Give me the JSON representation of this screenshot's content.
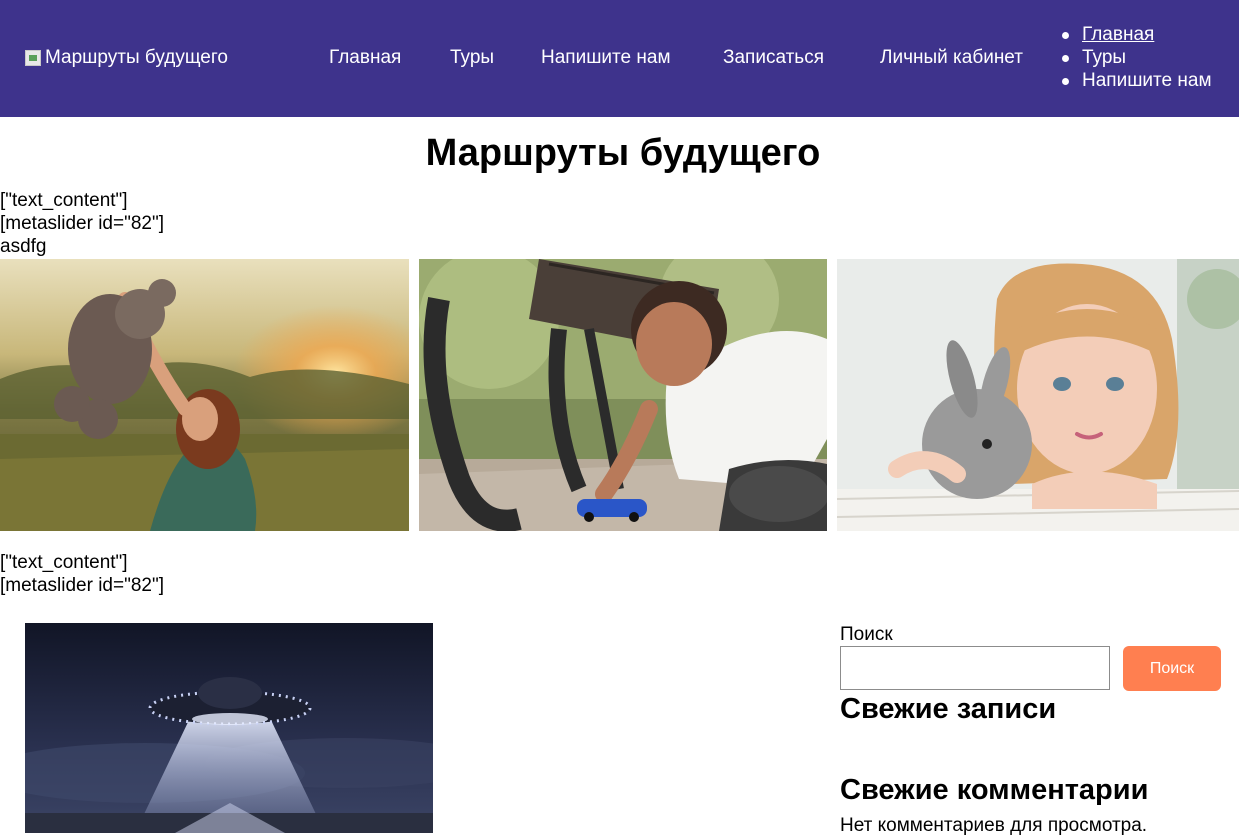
{
  "header": {
    "logo_alt": "Маршруты будущего",
    "nav": [
      "Главная",
      "Туры",
      "Напишите нам",
      "Записаться",
      "Личный кабинет"
    ],
    "side_nav": [
      "Главная",
      "Туры",
      "Напишите нам"
    ]
  },
  "main": {
    "title": "Маршруты будущего",
    "raw_block_1": [
      "[\"text_content\"]",
      "[metaslider id=\"82\"]",
      "asdfg"
    ],
    "raw_block_2": [
      "[\"text_content\"]",
      "[metaslider id=\"82\"]"
    ]
  },
  "sidebar": {
    "search_label": "Поиск",
    "search_value": "",
    "search_button": "Поиск",
    "recent_posts_title": "Свежие записи",
    "recent_comments_title": "Свежие комментарии",
    "no_comments": "Нет комментариев для просмотра."
  },
  "colors": {
    "header_bg": "#3e338c",
    "search_button_bg": "#ff7f50"
  }
}
